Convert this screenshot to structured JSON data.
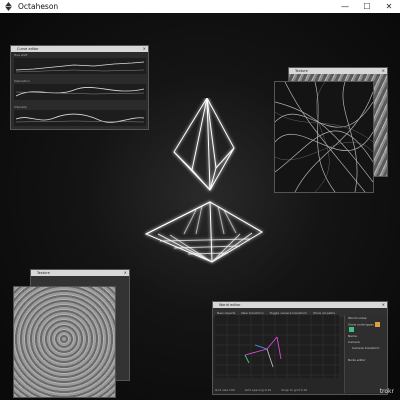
{
  "window": {
    "title": "Octaheson",
    "minimize": "—",
    "maximize": "☐",
    "close": "✕"
  },
  "curve_editor": {
    "title": "Curve editor",
    "rows": [
      {
        "label": "Hue shift"
      },
      {
        "label": "Saturation"
      },
      {
        "label": "Intensity"
      }
    ]
  },
  "texture_panel_a": {
    "title": "Texture"
  },
  "texture_panel_b": {
    "title": "Texture"
  },
  "world_editor": {
    "title": "World editor",
    "menu": [
      "New objects",
      "New transform",
      "Toggle camera transform",
      "Show all paths"
    ],
    "sidebar": {
      "heading": "World nodes",
      "show_node_types": "Show node types",
      "name_label": "Name",
      "tree_root": "Camera",
      "tree_child": "Camera transform",
      "node_editor": "Node editor"
    },
    "status": {
      "grid_size_label": "Grid size",
      "grid_size_value": "100",
      "grid_spacing_label": "Grid spacing",
      "grid_spacing_value": "0.10",
      "snap_label": "Snap to grid",
      "snap_value": "0.10"
    }
  },
  "watermark": "trokr"
}
